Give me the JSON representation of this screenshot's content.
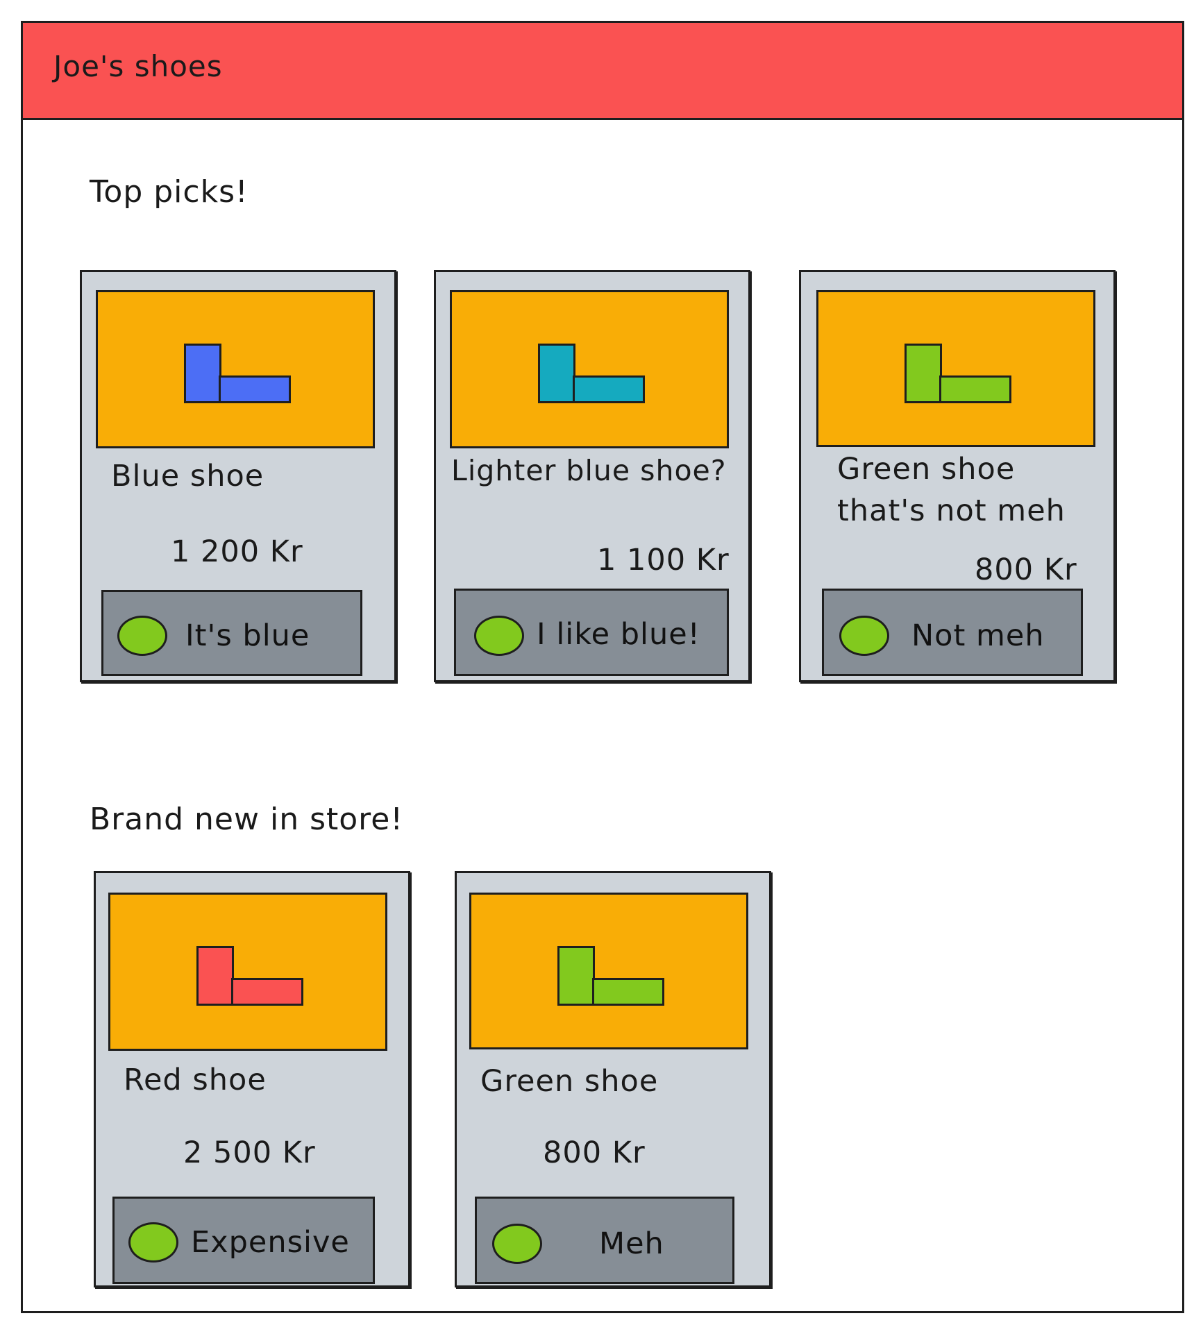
{
  "app": {
    "title": "Joe's shoes",
    "header_color": "#fa5252"
  },
  "sections": [
    {
      "title": "Top picks!",
      "cards": [
        {
          "name": "Blue shoe",
          "price": "1 200 Kr",
          "button_label": "It's blue",
          "shoe_color": "#4c6ef5",
          "image_icon": "shoe-icon"
        },
        {
          "name": "Lighter blue shoe?",
          "price": "1 100 Kr",
          "button_label": "I like blue!",
          "shoe_color": "#15aabf",
          "image_icon": "shoe-icon"
        },
        {
          "name": "Green shoe\nthat's not meh",
          "price": "800 Kr",
          "button_label": "Not meh",
          "shoe_color": "#82c91e",
          "image_icon": "shoe-icon"
        }
      ]
    },
    {
      "title": "Brand new in store!",
      "cards": [
        {
          "name": "Red shoe",
          "price": "2 500 Kr",
          "button_label": "Expensive",
          "shoe_color": "#fa5252",
          "image_icon": "shoe-icon"
        },
        {
          "name": "Green shoe",
          "price": "800 Kr",
          "button_label": "Meh",
          "shoe_color": "#82c91e",
          "image_icon": "shoe-icon"
        }
      ]
    }
  ],
  "colors": {
    "card_background": "#ced4da",
    "image_background": "#f9ad06",
    "button_background": "#868e96",
    "button_dot": "#82c91e",
    "outline": "#1e1e1e"
  }
}
